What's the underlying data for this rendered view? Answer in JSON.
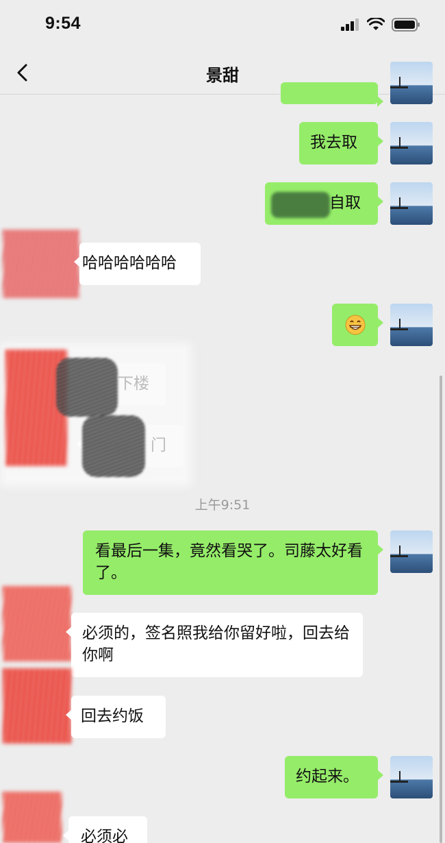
{
  "status": {
    "time": "9:54"
  },
  "header": {
    "title": "景甜"
  },
  "timestamp": "上午9:51",
  "messages": [
    {
      "side": "me",
      "text": "我去取"
    },
    {
      "side": "me",
      "text": "自取"
    },
    {
      "side": "them",
      "text": "哈哈哈哈哈哈"
    },
    {
      "side": "me",
      "text": "😁"
    },
    {
      "side": "them",
      "text": "下楼"
    },
    {
      "side": "them",
      "text": "门"
    },
    {
      "side": "me",
      "text": "看最后一集，竟然看哭了。司藤太好看了。"
    },
    {
      "side": "them",
      "text": "必须的，签名照我给你留好啦，回去给你啊"
    },
    {
      "side": "them",
      "text": "回去约饭"
    },
    {
      "side": "me",
      "text": "约起来。"
    },
    {
      "side": "them",
      "text": "必须必"
    }
  ],
  "colors": {
    "my_bubble": "#95ec69",
    "their_bubble": "#ffffff",
    "background": "#ededed"
  }
}
